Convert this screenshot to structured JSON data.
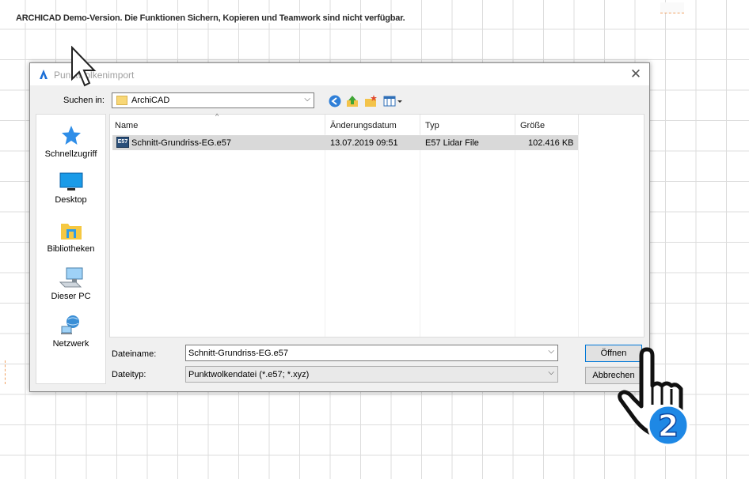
{
  "banner": "ARCHICAD Demo-Version. Die Funktionen Sichern, Kopieren und Teamwork sind nicht verfügbar.",
  "dialog": {
    "title": "Punktwolkenimport",
    "look_in_label": "Suchen in:",
    "look_in_value": "ArchiCAD",
    "toolbar_icons": [
      "back-icon",
      "up-folder-icon",
      "new-folder-icon",
      "view-menu-icon"
    ],
    "places": [
      {
        "label": "Schnellzugriff",
        "icon": "star-icon"
      },
      {
        "label": "Desktop",
        "icon": "desktop-icon"
      },
      {
        "label": "Bibliotheken",
        "icon": "libraries-icon"
      },
      {
        "label": "Dieser PC",
        "icon": "computer-icon"
      },
      {
        "label": "Netzwerk",
        "icon": "network-icon"
      }
    ],
    "columns": {
      "name": "Name",
      "date": "Änderungsdatum",
      "type": "Typ",
      "size": "Größe"
    },
    "files": [
      {
        "name": "Schnitt-Grundriss-EG.e57",
        "date": "13.07.2019 09:51",
        "type": "E57 Lidar File",
        "size": "102.416 KB",
        "icon_text": "E57"
      }
    ],
    "filename_label": "Dateiname:",
    "filename_value": "Schnitt-Grundriss-EG.e57",
    "filetype_label": "Dateityp:",
    "filetype_value": "Punktwolkendatei (*.e57; *.xyz)",
    "open_button": "Öffnen",
    "cancel_button": "Abbrechen"
  },
  "overlay": {
    "step_number": "2"
  },
  "colors": {
    "accent": "#0078d7",
    "selection": "#d9d9d9",
    "step_badge": "#1e88e5"
  }
}
